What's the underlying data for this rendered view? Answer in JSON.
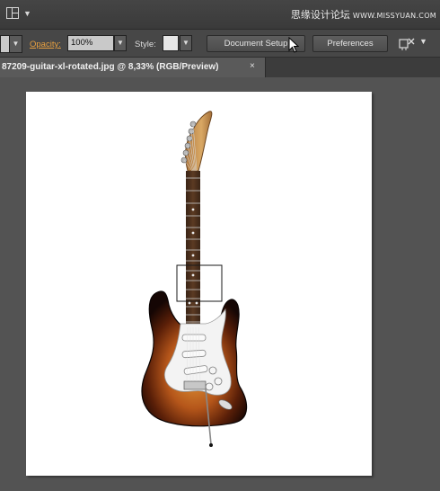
{
  "topbar": {
    "watermark_text": "思缘设计论坛",
    "watermark_url": "WWW.MISSYUAN.COM"
  },
  "control_bar": {
    "opacity_label": "Opacity:",
    "opacity_value": "100%",
    "style_label": "Style:",
    "document_setup_label": "Document Setup",
    "preferences_label": "Preferences"
  },
  "document_tab": {
    "title": "87209-guitar-xl-rotated.jpg @ 8,33% (RGB/Preview)",
    "close_symbol": "×"
  },
  "colors": {
    "opacity_label_accent": "#e8a040",
    "artboard": "#ffffff",
    "workspace": "#535353"
  },
  "icons": [
    "workspace-switcher-icon",
    "chevron-down-icon",
    "arrange-documents-icon",
    "close-icon",
    "mouse-pointer-icon"
  ]
}
